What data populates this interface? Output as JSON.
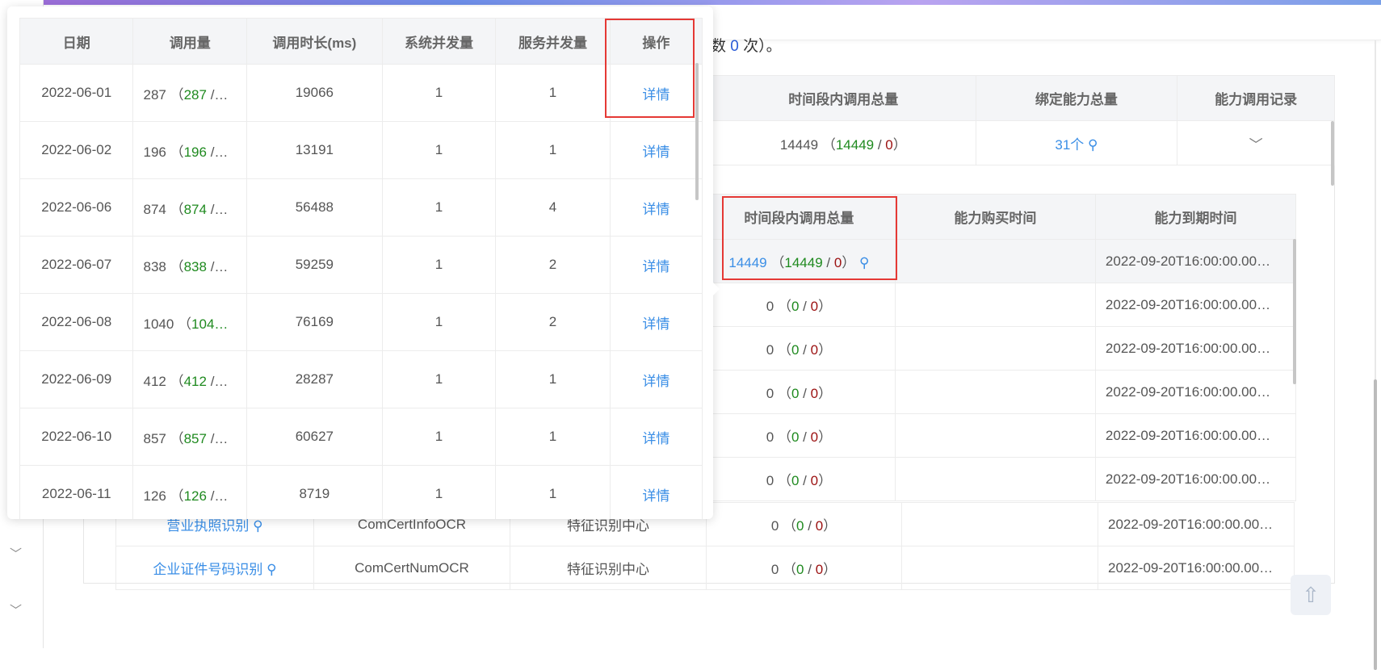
{
  "note": {
    "text": "数",
    "count": "0",
    "suffix": "次）。"
  },
  "summary_table": {
    "headers": [
      "时间段内调用总量",
      "绑定能力总量",
      "能力调用记录"
    ],
    "row": {
      "total": "14449",
      "success": "14449",
      "fail": "0",
      "bound": "31个"
    }
  },
  "ability_table": {
    "headers": [
      "时间段内调用总量",
      "能力购买时间",
      "能力到期时间"
    ],
    "rows": [
      {
        "total": "14449",
        "success": "14449",
        "fail": "0",
        "buy": "",
        "expire": "2022-09-20T16:00:00.00…"
      },
      {
        "total": "0",
        "success": "0",
        "fail": "0",
        "buy": "",
        "expire": "2022-09-20T16:00:00.00…"
      },
      {
        "total": "0",
        "success": "0",
        "fail": "0",
        "buy": "",
        "expire": "2022-09-20T16:00:00.00…"
      },
      {
        "total": "0",
        "success": "0",
        "fail": "0",
        "buy": "",
        "expire": "2022-09-20T16:00:00.00…"
      },
      {
        "total": "0",
        "success": "0",
        "fail": "0",
        "buy": "",
        "expire": "2022-09-20T16:00:00.00…"
      },
      {
        "total": "0",
        "success": "0",
        "fail": "0",
        "buy": "",
        "expire": "2022-09-20T16:00:00.00…"
      }
    ],
    "lower_rows": [
      {
        "name": "营业执照识别",
        "code": "ComCertInfoOCR",
        "center": "特征识别中心",
        "total": "0",
        "success": "0",
        "fail": "0",
        "buy": "",
        "expire": "2022-09-20T16:00:00.00…"
      },
      {
        "name": "企业证件号码识别",
        "code": "ComCertNumOCR",
        "center": "特征识别中心",
        "total": "0",
        "success": "0",
        "fail": "0",
        "buy": "",
        "expire": "2022-09-20T16:00:00.00…"
      }
    ]
  },
  "popup": {
    "headers": [
      "日期",
      "调用量",
      "调用时长(ms)",
      "系统并发量",
      "服务并发量",
      "操作"
    ],
    "rows": [
      {
        "date": "2022-06-01",
        "calls": "287",
        "calls_ok": "287",
        "duration": "19066",
        "sys": "1",
        "svc": "1",
        "op": "详情"
      },
      {
        "date": "2022-06-02",
        "calls": "196",
        "calls_ok": "196",
        "duration": "13191",
        "sys": "1",
        "svc": "1",
        "op": "详情"
      },
      {
        "date": "2022-06-06",
        "calls": "874",
        "calls_ok": "874",
        "duration": "56488",
        "sys": "1",
        "svc": "4",
        "op": "详情"
      },
      {
        "date": "2022-06-07",
        "calls": "838",
        "calls_ok": "838",
        "duration": "59259",
        "sys": "1",
        "svc": "2",
        "op": "详情"
      },
      {
        "date": "2022-06-08",
        "calls": "1040",
        "calls_ok": "104…",
        "duration": "76169",
        "sys": "1",
        "svc": "2",
        "op": "详情"
      },
      {
        "date": "2022-06-09",
        "calls": "412",
        "calls_ok": "412",
        "duration": "28287",
        "sys": "1",
        "svc": "1",
        "op": "详情"
      },
      {
        "date": "2022-06-10",
        "calls": "857",
        "calls_ok": "857",
        "duration": "60627",
        "sys": "1",
        "svc": "1",
        "op": "详情"
      },
      {
        "date": "2022-06-11",
        "calls": "126",
        "calls_ok": "126",
        "duration": "8719",
        "sys": "1",
        "svc": "1",
        "op": "详情"
      }
    ]
  },
  "icons": {
    "search": "search-icon",
    "chevron": "chevron-down-icon",
    "to_top": "arrow-up-icon"
  },
  "colors": {
    "link": "#3a8ee6",
    "success": "#1f8a1f",
    "fail": "#9b1010",
    "highlight": "#e53935"
  }
}
